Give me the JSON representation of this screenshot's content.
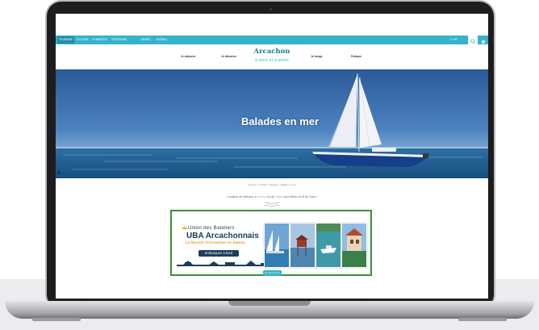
{
  "site": {
    "nav_items": [
      "Tourisme",
      "Culture",
      "Commerce",
      "Téléphone",
      "Mairie",
      "Agenda"
    ],
    "nav_active_index": 0,
    "lang": "FR",
    "logo_title": "Arcachon",
    "logo_tagline": "à vivre et à aimer",
    "main_menu": [
      "Je séjourne",
      "Je découvre",
      "Je bouge",
      "Pratique"
    ],
    "hero_title": "Balades en mer",
    "breadcrumb": "Tourisme  >  Activités  >  Balades  >  Balades en mer",
    "intro_before": "Location de bateaux, à ",
    "intro_hl1": "moteur",
    "intro_mid": " ou de ",
    "intro_hl2": "voilier",
    "intro_after": " pour flâner au fil de l'eau !",
    "see_more_label": "En savoir plus"
  },
  "banner": {
    "union_line": "Union des Bateliers",
    "uba_line": "UBA Arcachonnais",
    "subtitle": "Le Bassin d'Arcachon en bateau",
    "button_label": "Embarquez à bord"
  },
  "colors": {
    "accent": "#35b3cb",
    "banner_border": "#3a8f3a",
    "banner_text": "#143a5a",
    "banner_subtitle": "#e7a21e"
  },
  "icons": [
    "search-icon",
    "star-icon",
    "user-icon",
    "cookie-icon"
  ]
}
